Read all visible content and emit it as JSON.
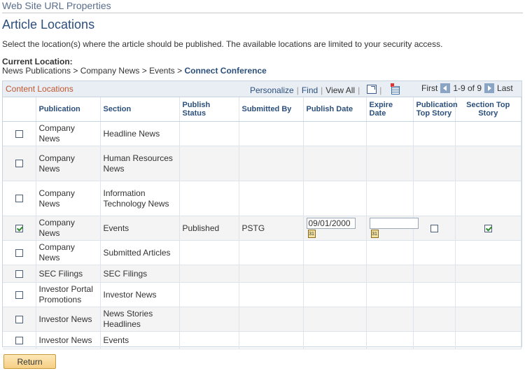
{
  "header": {
    "top_title": "Web Site URL Properties",
    "page_title": "Article Locations",
    "instructions": "Select the location(s) where the article should be published.  The available locations are limited to your security access.",
    "current_location_label": "Current Location:",
    "breadcrumb_prefix": "News Publications > Company News > Events > ",
    "breadcrumb_current": "Connect Conference"
  },
  "grid": {
    "caption": "Content Locations",
    "personalize": "Personalize",
    "find": "Find",
    "view_all": "View All",
    "first": "First",
    "range": "1-9 of 9",
    "last": "Last",
    "columns": [
      "Publication",
      "Section",
      "Publish Status",
      "Submitted By",
      "Publish Date",
      "Expire Date",
      "Publication Top Story",
      "Section Top Story"
    ],
    "rows": [
      {
        "selected": false,
        "publication": "Company News",
        "section": "Headline News",
        "status": "",
        "submitted_by": "",
        "publish_date": null,
        "expire_date": null
      },
      {
        "selected": false,
        "publication": "Company News",
        "section": "Human Resources News",
        "status": "",
        "submitted_by": "",
        "publish_date": null,
        "expire_date": null
      },
      {
        "selected": false,
        "publication": "Company News",
        "section": "Information Technology News",
        "status": "",
        "submitted_by": "",
        "publish_date": null,
        "expire_date": null
      },
      {
        "selected": true,
        "publication": "Company News",
        "section": "Events",
        "status": "Published",
        "submitted_by": "PSTG",
        "publish_date": "09/01/2000",
        "expire_date": "",
        "pub_top_story": false,
        "section_top_story": true
      },
      {
        "selected": false,
        "publication": "Company News",
        "section": "Submitted Articles",
        "status": "",
        "submitted_by": "",
        "publish_date": null,
        "expire_date": null
      },
      {
        "selected": false,
        "publication": "SEC Filings",
        "section": "SEC Filings",
        "status": "",
        "submitted_by": "",
        "publish_date": null,
        "expire_date": null
      },
      {
        "selected": false,
        "publication": "Investor Portal Promotions",
        "section": "Investor News",
        "status": "",
        "submitted_by": "",
        "publish_date": null,
        "expire_date": null
      },
      {
        "selected": false,
        "publication": "Investor News",
        "section": "News Stories Headlines",
        "status": "",
        "submitted_by": "",
        "publish_date": null,
        "expire_date": null
      },
      {
        "selected": false,
        "publication": "Investor News",
        "section": "Events",
        "status": "",
        "submitted_by": "",
        "publish_date": null,
        "expire_date": null
      }
    ]
  },
  "icons": {
    "zoom": "zoom-grid-icon",
    "download": "download-to-excel-icon",
    "calendar": "calendar-icon",
    "first": "first-page-arrow-icon",
    "next": "next-page-arrow-icon"
  },
  "calendar_glyph": "31",
  "buttons": {
    "return": "Return"
  },
  "colors": {
    "title_blue": "#2c4f7c",
    "caption_orange": "#c0562f",
    "header_bg": "#e8eef4",
    "check_green": "#2e8b2e",
    "button_bg": "#f6cf83"
  }
}
